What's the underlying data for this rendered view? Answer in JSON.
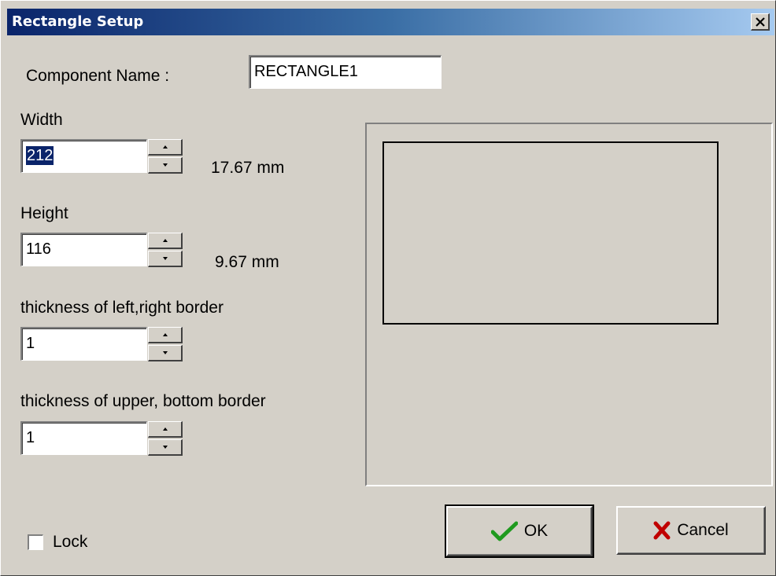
{
  "window": {
    "title": "Rectangle Setup",
    "close_label": "×"
  },
  "component_name": {
    "label": "Component Name :",
    "value": "RECTANGLE1"
  },
  "width": {
    "label": "Width",
    "value": "212",
    "mm": "17.67 mm"
  },
  "height": {
    "label": "Height",
    "value": "116",
    "mm": "9.67 mm"
  },
  "thickness_lr": {
    "label": "thickness of left,right border",
    "value": "1"
  },
  "thickness_ub": {
    "label": "thickness of upper, bottom border",
    "value": "1"
  },
  "lock": {
    "label": "Lock",
    "checked": false
  },
  "buttons": {
    "ok_label": "OK",
    "cancel_label": "Cancel"
  },
  "icons": {
    "close": "close-icon",
    "spin_up": "arrow-up-icon",
    "spin_down": "arrow-down-icon",
    "ok": "checkmark-icon",
    "cancel": "x-mark-icon"
  },
  "colors": {
    "title_start": "#0a246a",
    "title_end": "#a6caf0",
    "face": "#d4d0c8",
    "selection": "#0a246a",
    "ok_check": "#1f9a1f",
    "cancel_x": "#c00000"
  }
}
